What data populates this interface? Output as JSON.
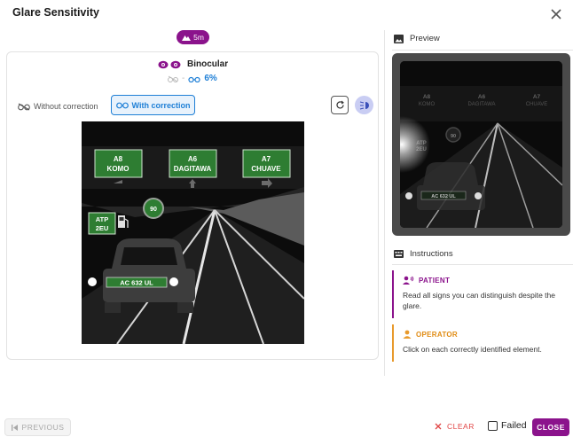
{
  "window": {
    "title": "Glare Sensitivity"
  },
  "distance_badge": {
    "icon": "mountain-icon",
    "label": "5m"
  },
  "eye": {
    "icon": "eyes-icon",
    "label": "Binocular"
  },
  "acuity": {
    "without_correction_value": "-",
    "with_correction_value": "6%"
  },
  "correction": {
    "without_label": "Without correction",
    "with_label": "With correction",
    "selected": "with"
  },
  "scene": {
    "signs": [
      {
        "code": "A8",
        "name": "KOMO",
        "arrow": "left"
      },
      {
        "code": "A6",
        "name": "DAGITAWA",
        "arrow": "up"
      },
      {
        "code": "A7",
        "name": "CHUAVE",
        "arrow": "right"
      }
    ],
    "speed_limit": "90",
    "station_sign": {
      "line1": "ATP",
      "line2": "2EU"
    },
    "license_plate": "AC 632 UL"
  },
  "sidebar": {
    "preview_label": "Preview",
    "instructions_label": "Instructions",
    "patient": {
      "title": "PATIENT",
      "text": "Read all signs you can distinguish despite the glare."
    },
    "operator": {
      "title": "OPERATOR",
      "text": "Click on each correctly identified element."
    }
  },
  "footer": {
    "previous_label": "PREVIOUS",
    "clear_label": "CLEAR",
    "failed_label": "Failed",
    "close_label": "CLOSE"
  },
  "colors": {
    "accent": "#8b138c",
    "link": "#1e7fd6",
    "sign_green": "#2e7d32",
    "danger": "#e04343",
    "operator": "#e89a2c"
  }
}
